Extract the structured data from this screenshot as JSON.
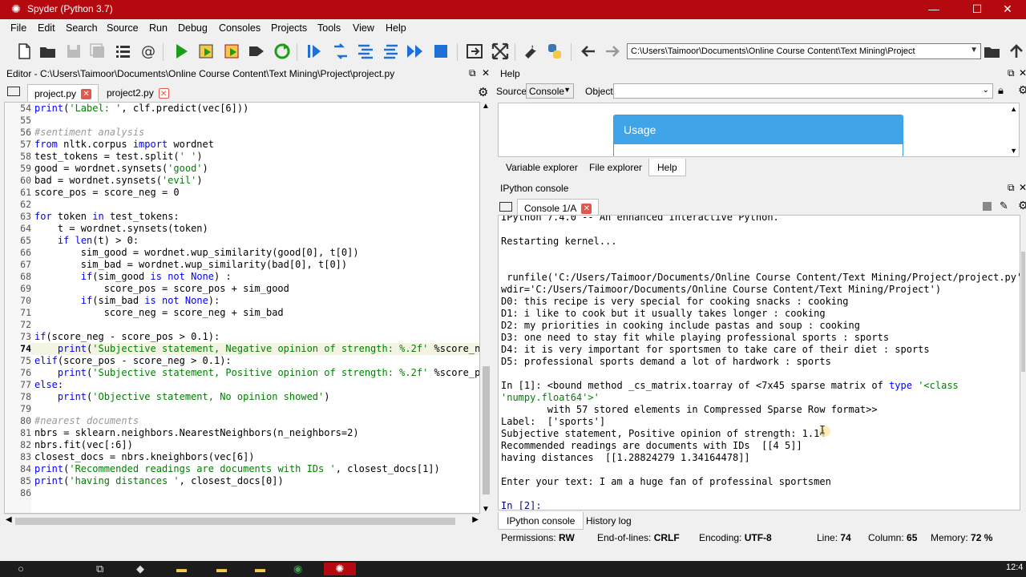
{
  "window": {
    "title": "Spyder (Python 3.7)",
    "minimize": "—",
    "maximize": "☐",
    "close": "✕"
  },
  "menu": [
    "File",
    "Edit",
    "Search",
    "Source",
    "Run",
    "Debug",
    "Consoles",
    "Projects",
    "Tools",
    "View",
    "Help"
  ],
  "toolbar": {
    "path": "C:\\Users\\Taimoor\\Documents\\Online Course Content\\Text Mining\\Project"
  },
  "editor": {
    "header": "Editor - C:\\Users\\Taimoor\\Documents\\Online Course Content\\Text Mining\\Project\\project.py",
    "tabs": [
      "project.py",
      "project2.py"
    ],
    "line_numbers": [
      "54",
      "55",
      "56",
      "57",
      "58",
      "59",
      "60",
      "61",
      "62",
      "63",
      "64",
      "65",
      "66",
      "67",
      "68",
      "69",
      "70",
      "71",
      "72",
      "73",
      "74",
      "75",
      "76",
      "77",
      "78",
      "79",
      "80",
      "81",
      "82",
      "83",
      "84",
      "85",
      "86"
    ],
    "current_line": "74",
    "code": [
      "print('Label: ', clf.predict(vec[6]))",
      "",
      "#sentiment analysis",
      "from nltk.corpus import wordnet",
      "test_tokens = test.split(' ')",
      "good = wordnet.synsets('good')",
      "bad = wordnet.synsets('evil')",
      "score_pos = score_neg = 0",
      "",
      "for token in test_tokens:",
      "    t = wordnet.synsets(token)",
      "    if len(t) > 0:",
      "        sim_good = wordnet.wup_similarity(good[0], t[0])",
      "        sim_bad = wordnet.wup_similarity(bad[0], t[0])",
      "        if(sim_good is not None) :",
      "            score_pos = score_pos + sim_good",
      "        if(sim_bad is not None):",
      "            score_neg = score_neg + sim_bad",
      "",
      "if(score_neg - score_pos > 0.1):",
      "    print('Subjective statement, Negative opinion of strength: %.2f' %score_ne",
      "elif(score_pos - score_neg > 0.1):",
      "    print('Subjective statement, Positive opinion of strength: %.2f' %score_po",
      "else:",
      "    print('Objective statement, No opinion showed')",
      "",
      "#nearest documents",
      "nbrs = sklearn.neighbors.NearestNeighbors(n_neighbors=2)",
      "nbrs.fit(vec[:6])",
      "closest_docs = nbrs.kneighbors(vec[6])",
      "print('Recommended readings are documents with IDs ', closest_docs[1])",
      "print('having distances ', closest_docs[0])",
      ""
    ]
  },
  "help": {
    "title": "Help",
    "source_label": "Source",
    "source_value": "Console",
    "object_label": "Object",
    "usage_title": "Usage",
    "tabs": [
      "Variable explorer",
      "File explorer",
      "Help"
    ]
  },
  "console": {
    "title": "IPython console",
    "tab": "Console 1/A",
    "lines": [
      "IPython 7.4.0 -- An enhanced Interactive Python.",
      "",
      "Restarting kernel...",
      "",
      "",
      " runfile('C:/Users/Taimoor/Documents/Online Course Content/Text Mining/Project/project.py',",
      "wdir='C:/Users/Taimoor/Documents/Online Course Content/Text Mining/Project')",
      "D0: this recipe is very special for cooking snacks : cooking",
      "D1: i like to cook but it usually takes longer : cooking",
      "D2: my priorities in cooking include pastas and soup : cooking",
      "D3: one need to stay fit while playing professional sports : sports",
      "D4: it is very important for sportsmen to take care of their diet : sports",
      "D5: professional sports demand a lot of hardwork : sports",
      "",
      "In [1]: <bound method _cs_matrix.toarray of <7x45 sparse matrix of type '<class",
      "'numpy.float64'>'",
      "        with 57 stored elements in Compressed Sparse Row format>>",
      "Label:  ['sports']",
      "Subjective statement, Positive opinion of strength: 1.14",
      "Recommended readings are documents with IDs  [[4 5]]",
      "having distances  [[1.28824279 1.34164478]]",
      "",
      "Enter your text: I am a huge fan of professinal sportsmen",
      "",
      "In [2]:"
    ],
    "bottom_tabs": [
      "IPython console",
      "History log"
    ]
  },
  "status": {
    "permissions_label": "Permissions:",
    "permissions": "RW",
    "eol_label": "End-of-lines:",
    "eol": "CRLF",
    "encoding_label": "Encoding:",
    "encoding": "UTF-8",
    "line_label": "Line:",
    "line": "74",
    "column_label": "Column:",
    "column": "65",
    "memory_label": "Memory:",
    "memory": "72 %"
  },
  "taskbar": {
    "clock": "12:4"
  },
  "colors": {
    "titlebar": "#b3090f",
    "keyword": "#0000ff",
    "string": "#008000",
    "comment": "#999999",
    "usage_header": "#3fa5e8"
  }
}
